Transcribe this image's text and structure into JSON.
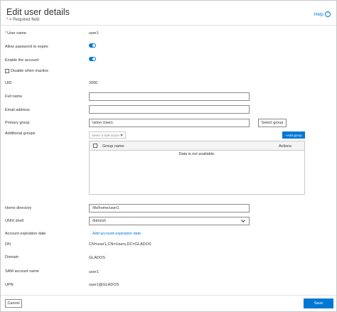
{
  "header": {
    "title": "Edit user details",
    "required_star": "*",
    "required_note": " = Required field",
    "help_label": "Help",
    "help_icon": "?"
  },
  "fields": {
    "user_name_label": "User name",
    "user_name_value": "user1",
    "allow_password_expire_label": "Allow password to expire",
    "allow_password_expire_on": true,
    "enable_account_label": "Enable the account",
    "enable_account_on": true,
    "disable_when_inactive_label": "Disable when inactive",
    "uid_label": "UID",
    "uid_value": "2000",
    "full_name_label": "Full name",
    "full_name_value": "",
    "email_label": "Email address",
    "email_value": "",
    "primary_group_label": "Primary group",
    "primary_group_value": "Isilon Users",
    "select_group_label": "Select group",
    "additional_groups_label": "Additional groups",
    "bulk_action_placeholder": "Select a bulk action",
    "add_group_label": "+Add group",
    "home_directory_label": "Home directory",
    "home_directory_value": "/ifs/home/user1",
    "unix_shell_label": "UNIX shell",
    "unix_shell_value": "/bin/zsh",
    "account_expiration_label": "Account expiration date",
    "add_expiration_link": "Add account expiration date",
    "dn_label": "DN",
    "dn_value": "CN=user1,CN=Users,DC=GLADOS",
    "domain_label": "Domain",
    "domain_value": "GLADOS",
    "sam_label": "SAM account name",
    "sam_value": "user1",
    "upn_label": "UPN",
    "upn_value": "user1@GLADOS"
  },
  "groups_table": {
    "col_name": "Group name",
    "col_actions": "Actions",
    "empty_message": "Data is not available."
  },
  "footer": {
    "cancel_label": "Cancel",
    "save_label": "Save"
  },
  "colors": {
    "accent": "#0078d4",
    "required": "#d13438"
  }
}
